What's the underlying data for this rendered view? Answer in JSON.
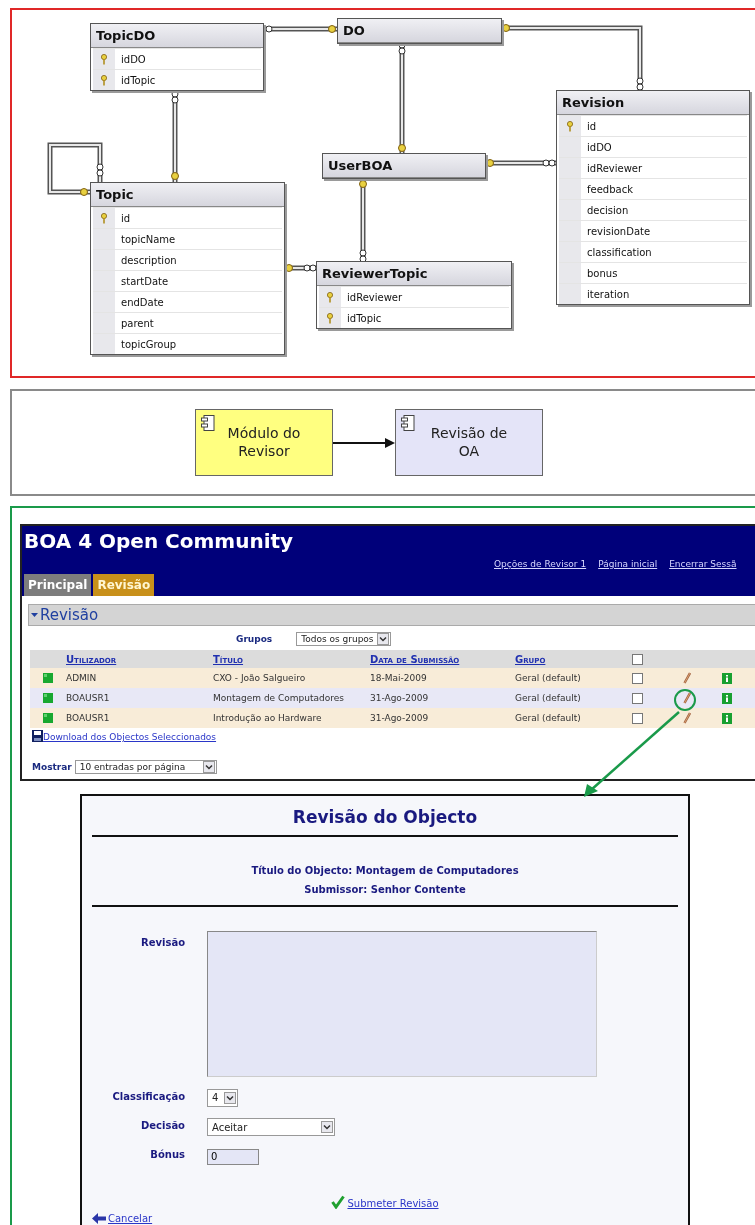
{
  "er_diagram": {
    "tables": [
      {
        "name": "TopicDO",
        "columns": [
          {
            "name": "idDO",
            "key": true
          },
          {
            "name": "idTopic",
            "key": true
          }
        ]
      },
      {
        "name": "DO"
      },
      {
        "name": "Revision",
        "columns": [
          {
            "name": "id",
            "key": true
          },
          {
            "name": "idDO",
            "key": false
          },
          {
            "name": "idReviewer",
            "key": false
          },
          {
            "name": "feedback",
            "key": false
          },
          {
            "name": "decision",
            "key": false
          },
          {
            "name": "revisionDate",
            "key": false
          },
          {
            "name": "classification",
            "key": false
          },
          {
            "name": "bonus",
            "key": false
          },
          {
            "name": "iteration",
            "key": false
          }
        ]
      },
      {
        "name": "UserBOA"
      },
      {
        "name": "Topic",
        "columns": [
          {
            "name": "id",
            "key": true
          },
          {
            "name": "topicName",
            "key": false
          },
          {
            "name": "description",
            "key": false
          },
          {
            "name": "startDate",
            "key": false
          },
          {
            "name": "endDate",
            "key": false
          },
          {
            "name": "parent",
            "key": false
          },
          {
            "name": "topicGroup",
            "key": false
          }
        ]
      },
      {
        "name": "ReviewerTopic",
        "columns": [
          {
            "name": "idReviewer",
            "key": true
          },
          {
            "name": "idTopic",
            "key": true
          }
        ]
      }
    ]
  },
  "component_diagram": {
    "components": [
      {
        "label": "Módulo do Revisor",
        "color": "#ffff80"
      },
      {
        "label": "Revisão de OA",
        "color": "#e4e4f8"
      }
    ]
  },
  "app": {
    "title": "BOA 4 Open Community",
    "header_links": [
      "Opções de Revisor 1",
      "Página inicial",
      "Encerrar Sessã"
    ],
    "tabs": [
      {
        "label": "Principal",
        "selected": false
      },
      {
        "label": "Revisão",
        "selected": true
      }
    ],
    "section": {
      "title": "Revisão",
      "expanded": true
    },
    "groups_filter": {
      "label": "Grupos",
      "value": "Todos os grupos"
    },
    "table": {
      "columns": [
        "Utilizador",
        "Título",
        "Data de Submissão",
        "Grupo"
      ],
      "select_all_checked": false,
      "rows": [
        {
          "user": "ADMIN",
          "title": "CXO - João Salgueiro",
          "date": "18-Mai-2009",
          "group": "Geral (default)",
          "checked": false,
          "annotated": false
        },
        {
          "user": "BOAUSR1",
          "title": "Montagem de Computadores",
          "date": "31-Ago-2009",
          "group": "Geral (default)",
          "checked": false,
          "annotated": true
        },
        {
          "user": "BOAUSR1",
          "title": "Introdução ao Hardware",
          "date": "31-Ago-2009",
          "group": "Geral (default)",
          "checked": false,
          "annotated": false
        }
      ]
    },
    "download_link": "Download dos Objectos Seleccionados",
    "page_size": {
      "label": "Mostrar",
      "value": "10 entradas por página"
    }
  },
  "review_dialog": {
    "title": "Revisão do Objecto",
    "object_title": "Título do Objecto: Montagem de Computadores",
    "submitter": "Submissor: Senhor Contente",
    "fields": [
      {
        "kind": "textarea",
        "label": "Revisão"
      },
      {
        "kind": "select",
        "label": "Classificação",
        "value": "4"
      },
      {
        "kind": "select",
        "label": "Decisão",
        "value": "Aceitar"
      },
      {
        "kind": "input",
        "label": "Bónus",
        "value": "0"
      }
    ],
    "submit": "Submeter Revisão",
    "cancel": "Cancelar"
  }
}
